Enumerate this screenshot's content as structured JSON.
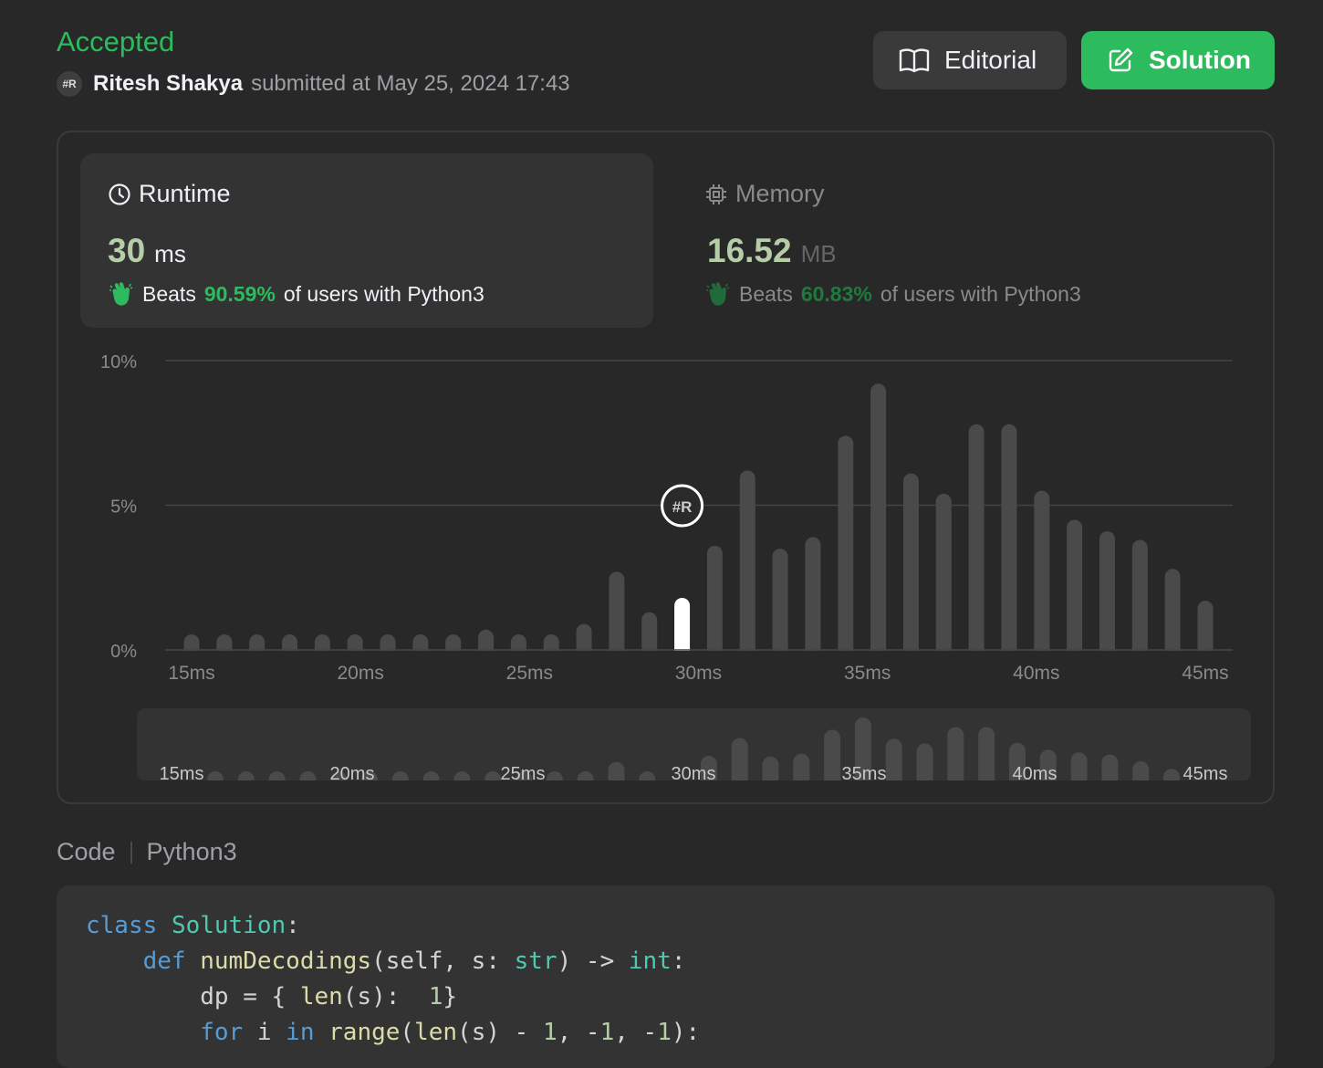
{
  "header": {
    "status": "Accepted",
    "user": "Ritesh Shakya",
    "submitted_text": "submitted at May 25, 2024 17:43",
    "avatar_text": "#R"
  },
  "buttons": {
    "editorial": "Editorial",
    "solution": "Solution"
  },
  "runtime": {
    "label": "Runtime",
    "value": "30",
    "unit": "ms",
    "beats_prefix": "Beats",
    "beats_pct": "90.59%",
    "beats_suffix": "of users with Python3"
  },
  "memory": {
    "label": "Memory",
    "value": "16.52",
    "unit": "MB",
    "beats_prefix": "Beats",
    "beats_pct": "60.83%",
    "beats_suffix": "of users with Python3"
  },
  "chart_data": {
    "type": "bar",
    "categories": [
      15,
      16,
      17,
      18,
      19,
      20,
      21,
      22,
      23,
      24,
      25,
      26,
      27,
      28,
      29,
      30,
      31,
      32,
      33,
      34,
      35,
      36,
      37,
      38,
      39,
      40,
      41,
      42,
      43,
      44,
      45
    ],
    "values": [
      0.3,
      0.3,
      0.3,
      0.3,
      0.3,
      0.3,
      0.3,
      0.3,
      0.3,
      0.7,
      0.3,
      0.4,
      0.9,
      2.7,
      1.3,
      1.8,
      3.6,
      6.2,
      3.5,
      3.9,
      7.4,
      9.2,
      6.1,
      5.4,
      7.8,
      7.8,
      5.5,
      4.5,
      4.1,
      3.8,
      2.8,
      1.7
    ],
    "highlight_category": 30,
    "y_ticks": [
      "10%",
      "5%",
      "0%"
    ],
    "x_ticks": [
      "15ms",
      "20ms",
      "25ms",
      "30ms",
      "35ms",
      "40ms",
      "45ms"
    ],
    "ylim": [
      0,
      10
    ],
    "colors": {
      "bar": "#4a4a4a",
      "highlight": "#ffffff",
      "grid": "#444444"
    }
  },
  "code_section": {
    "label": "Code",
    "language": "Python3"
  },
  "code_lines": {
    "l1_kw": "class",
    "l1_cls": "Solution",
    "l1_rest": ":",
    "l2_kw": "def",
    "l2_fn": "numDecodings",
    "l2_a": "(self, s: ",
    "l2_t1": "str",
    "l2_b": ") -> ",
    "l2_t2": "int",
    "l2_c": ":",
    "l3_a": "dp = { ",
    "l3_fn": "len",
    "l3_b": "(s):  ",
    "l3_num": "1",
    "l3_c": "}",
    "l4_kw1": "for",
    "l4_a": " i ",
    "l4_kw2": "in",
    "l4_sp": " ",
    "l4_fn1": "range",
    "l4_b": "(",
    "l4_fn2": "len",
    "l4_c": "(s) - ",
    "l4_n1": "1",
    "l4_d": ", -",
    "l4_n2": "1",
    "l4_e": ", -",
    "l4_n3": "1",
    "l4_f": "):"
  }
}
